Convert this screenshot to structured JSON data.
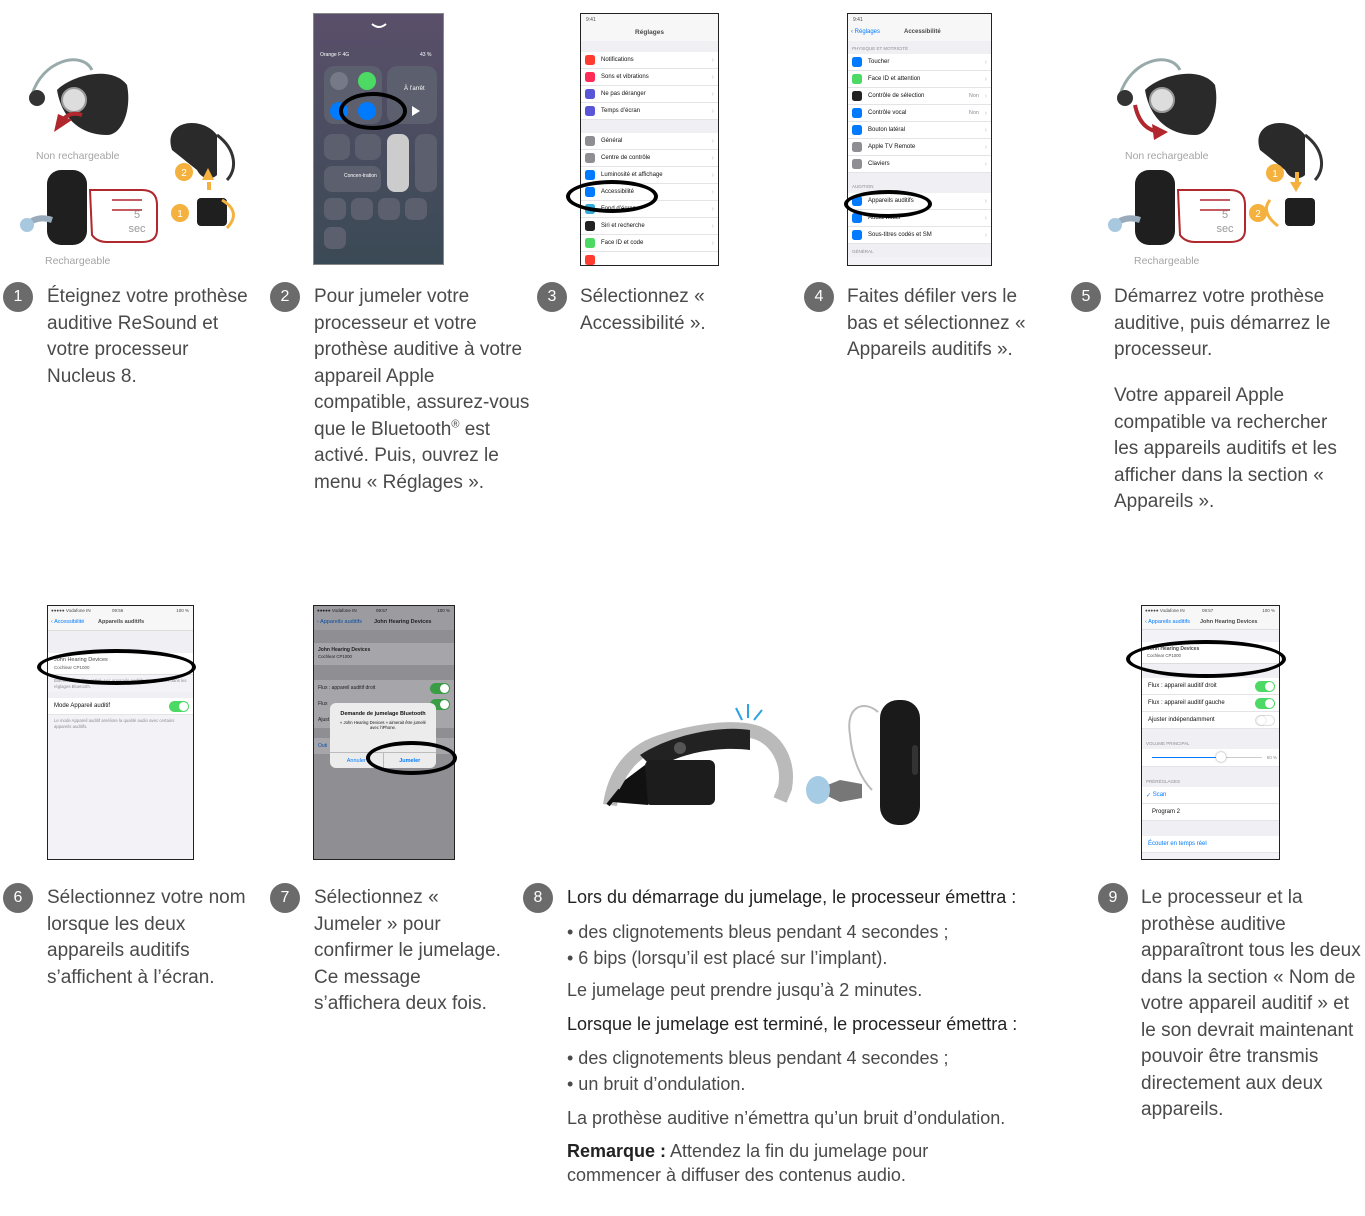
{
  "device_captions": {
    "non_rechargeable": "Non rechargeable",
    "rechargeable": "Rechargeable",
    "sec_number": "5",
    "sec_unit": "sec",
    "badge1": "1",
    "badge2": "2"
  },
  "steps": [
    {
      "num": "1",
      "text": "Éteignez votre prothèse auditive ReSound et votre processeur Nucleus 8."
    },
    {
      "num": "2",
      "text_before": "Pour jumeler votre processeur et votre prothèse auditive à votre appareil Apple compatible, assurez-vous que le Bluetooth",
      "sup": "®",
      "text_after": " est activé. Puis, ouvrez le menu « Réglages »."
    },
    {
      "num": "3",
      "text": "Sélectionnez « Accessibilité »."
    },
    {
      "num": "4",
      "text": "Faites défiler vers le bas et sélectionnez « Appareils auditifs »."
    },
    {
      "num": "5",
      "text": "Démarrez votre prothèse auditive, puis démarrez le processeur.",
      "text2": "Votre appareil Apple compatible va rechercher les appareils auditifs et les afficher dans la section « Appareils »."
    },
    {
      "num": "6",
      "text": "Sélectionnez votre nom lorsque les deux appareils auditifs s’affichent à l’écran."
    },
    {
      "num": "7",
      "text": "Sélectionnez « Jumeler » pour confirmer le jumelage. Ce message s’affichera deux fois."
    },
    {
      "num": "8",
      "heading": "Lors du démarrage du jumelage, le processeur émettra :",
      "bullets1": [
        "• des clignotements bleus pendant 4 secondes ;",
        "• 6 bips (lorsqu’il est placé sur l’implant)."
      ],
      "para1": "Le jumelage peut prendre jusqu’à 2 minutes.",
      "heading2": "Lorsque le jumelage est terminé, le processeur émettra :",
      "bullets2": [
        "• des clignotements bleus pendant 4 secondes ;",
        "• un bruit d’ondulation."
      ],
      "para2": "La prothèse auditive n’émettra qu’un bruit d’ondulation.",
      "note_label": "Remarque :",
      "note_text": " Attendez la fin du jumelage pour commencer à diffuser des contenus audio."
    },
    {
      "num": "9",
      "text": "Le processeur et la prothèse auditive apparaîtront tous les deux dans la section « Nom de votre appareil auditif » et le son devrait maintenant pouvoir être transmis directement aux deux appareils."
    }
  ],
  "screen2": {
    "carrier": "Orange F 4G",
    "battery": "43 %",
    "off_label": "À l’arrêt",
    "focus": "Concen-tration"
  },
  "screen3": {
    "time": "9:41",
    "title": "Réglages",
    "group1": [
      "Notifications",
      "Sons et vibrations",
      "Ne pas déranger",
      "Temps d’écran"
    ],
    "group2": [
      "Général",
      "Centre de contrôle",
      "Luminosité et affichage",
      "Accessibilité",
      "Fond d’écran",
      "Siri et recherche",
      "Face ID et code"
    ]
  },
  "screen4": {
    "time": "9:41",
    "back": "Réglages",
    "title": "Accessibilité",
    "section1": "PHYSIQUE ET MOTRICITÉ",
    "group1": [
      "Toucher",
      "Face ID et attention",
      "Contrôle de sélection",
      "Contrôle vocal",
      "Bouton latéral",
      "Apple TV Remote",
      "Claviers"
    ],
    "value_off": "Non",
    "section2": "AUDITION",
    "group2": [
      "Appareils auditifs",
      "Audio/visuel",
      "Sous-titres codés et SM"
    ],
    "section3": "GÉNÉRAL"
  },
  "screen6": {
    "carrier": "●●●●● Vodafone IN",
    "time": "09:56",
    "battery": "100 %",
    "back": "Accessibilité",
    "title": "Appareils auditifs",
    "device": "John Hearing Devices",
    "model": "Cochlear CP1000",
    "hint": "Bluetooth doit être activé. Les appareils auditifs sont jumelés dans les réglages Bluetooth.",
    "mode": "Mode Appareil auditif",
    "mode_hint": "Le mode Appareil auditif améliore la qualité audio avec certains appareils auditifs."
  },
  "screen7": {
    "carrier": "●●●●● Vodafone IN",
    "time": "09:57",
    "battery": "100 %",
    "back": "Appareils auditifs",
    "title": "John Hearing Devices",
    "device": "John Hearing Devices",
    "model": "Cochlear CP1000",
    "row1": "Flux : appareil auditif droit",
    "row2": "Flux",
    "row3": "Ajust",
    "row4": "Outi",
    "dialog_title": "Demande de jumelage Bluetooth",
    "dialog_text": "« John Hearing Devices » aimerait être jumelé avec l’iPhone.",
    "cancel": "Annuler",
    "confirm": "Jumeler"
  },
  "screen9": {
    "carrier": "●●●●● Vodafone IN",
    "time": "09:57",
    "battery": "100 %",
    "back": "Appareils auditifs",
    "title": "John Hearing Devices",
    "device": "John Hearing Devices",
    "model": "Cochlear CP1000",
    "rows": [
      "Flux : appareil auditif droit",
      "Flux : appareil auditif gauche",
      "Ajuster indépendamment"
    ],
    "volume_label": "VOLUME PRINCIPAL",
    "volume_value": "60 %",
    "presets_label": "PRÉRÉGLAGES",
    "preset1": "Scan",
    "preset2": "Program 2",
    "live": "Écouter en temps réel"
  },
  "colors": {
    "badge": "#6b6b6b",
    "text": "#4a4a4a",
    "ios_blue": "#007aff",
    "ios_green": "#4cd964",
    "arrow_red": "#b0272d",
    "arrow_yellow": "#f4b13e"
  }
}
